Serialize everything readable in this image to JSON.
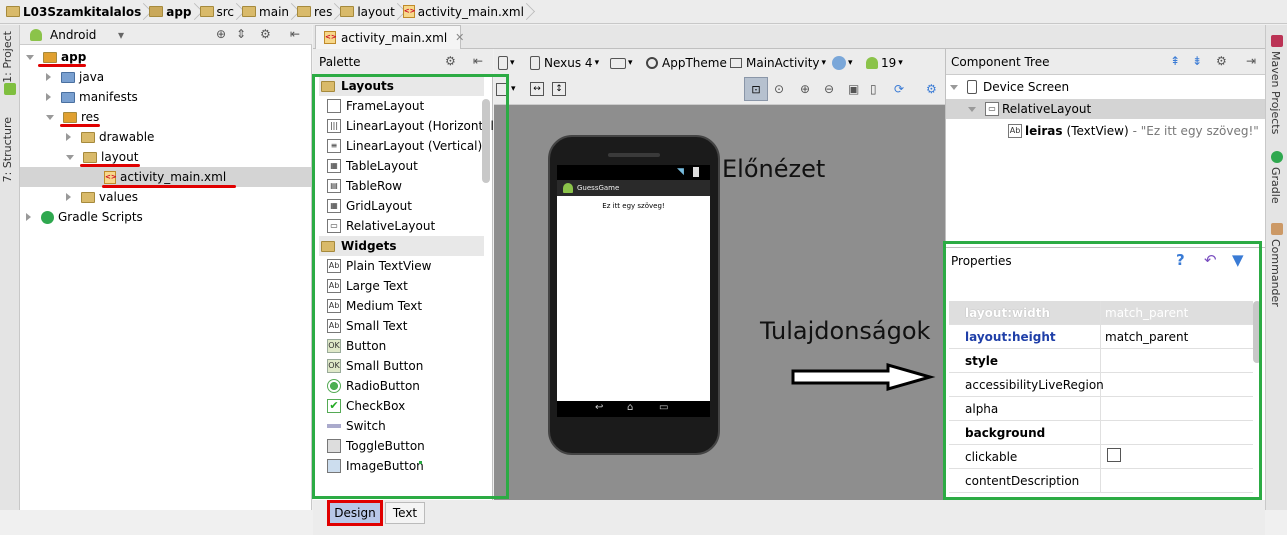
{
  "breadcrumb": [
    "L03Szamkitalalos",
    "app",
    "src",
    "main",
    "res",
    "layout",
    "activity_main.xml"
  ],
  "left_strip": {
    "project": "1: Project",
    "structure": "7: Structure"
  },
  "right_strip": {
    "maven": "Maven Projects",
    "gradle": "Gradle",
    "commander": "Commander"
  },
  "project": {
    "view_selector": "Android",
    "tree": [
      {
        "label": "app",
        "level": 0,
        "open": true,
        "icon": "module-folder-icon"
      },
      {
        "label": "java",
        "level": 1,
        "open": false,
        "icon": "folder-icon"
      },
      {
        "label": "manifests",
        "level": 1,
        "open": false,
        "icon": "folder-icon"
      },
      {
        "label": "res",
        "level": 1,
        "open": true,
        "icon": "res-folder-icon"
      },
      {
        "label": "drawable",
        "level": 2,
        "open": false,
        "icon": "folder-icon"
      },
      {
        "label": "layout",
        "level": 2,
        "open": true,
        "icon": "folder-icon"
      },
      {
        "label": "activity_main.xml",
        "level": 3,
        "icon": "xml-file-icon",
        "selected": true
      },
      {
        "label": "values",
        "level": 2,
        "open": false,
        "icon": "folder-icon"
      },
      {
        "label": "Gradle Scripts",
        "level": 0,
        "open": false,
        "icon": "gradle-icon"
      }
    ]
  },
  "editor_tab": "activity_main.xml",
  "palette": {
    "title": "Palette",
    "sections": [
      {
        "name": "Layouts",
        "items": [
          "FrameLayout",
          "LinearLayout (Horizontal)",
          "LinearLayout (Vertical)",
          "TableLayout",
          "TableRow",
          "GridLayout",
          "RelativeLayout"
        ]
      },
      {
        "name": "Widgets",
        "items": [
          "Plain TextView",
          "Large Text",
          "Medium Text",
          "Small Text",
          "Button",
          "Small Button",
          "RadioButton",
          "CheckBox",
          "Switch",
          "ToggleButton",
          "ImageButton"
        ]
      }
    ]
  },
  "toolbar": {
    "device": "Nexus 4",
    "theme": "AppTheme",
    "activity": "MainActivity",
    "api": "19"
  },
  "preview": {
    "app_title": "GuessGame",
    "text": "Ez itt egy szöveg!"
  },
  "annotations": {
    "preview": "Előnézet",
    "properties": "Tulajdonságok"
  },
  "component_tree": {
    "title": "Component Tree",
    "items": [
      {
        "label": "Device Screen"
      },
      {
        "label": "RelativeLayout"
      },
      {
        "id": "leiras",
        "type": "(TextView)",
        "text": "- \"Ez itt egy szöveg!\""
      }
    ]
  },
  "properties": {
    "title": "Properties",
    "rows": [
      {
        "name": "layout:width",
        "value": "match_parent",
        "style": "disabled"
      },
      {
        "name": "layout:height",
        "value": "match_parent",
        "style": "blue"
      },
      {
        "name": "style",
        "value": "",
        "style": "bold"
      },
      {
        "name": "accessibilityLiveRegion",
        "value": "",
        "style": "normal"
      },
      {
        "name": "alpha",
        "value": "",
        "style": "normal"
      },
      {
        "name": "background",
        "value": "",
        "style": "bold"
      },
      {
        "name": "clickable",
        "value": "",
        "style": "normal",
        "checkbox": true
      },
      {
        "name": "contentDescription",
        "value": "",
        "style": "normal"
      }
    ]
  },
  "bottom_tabs": {
    "design": "Design",
    "text": "Text"
  },
  "colors": {
    "green_box": "#2cab44",
    "red_mark": "#e00000",
    "selected_tab": "#b8c8e8"
  }
}
